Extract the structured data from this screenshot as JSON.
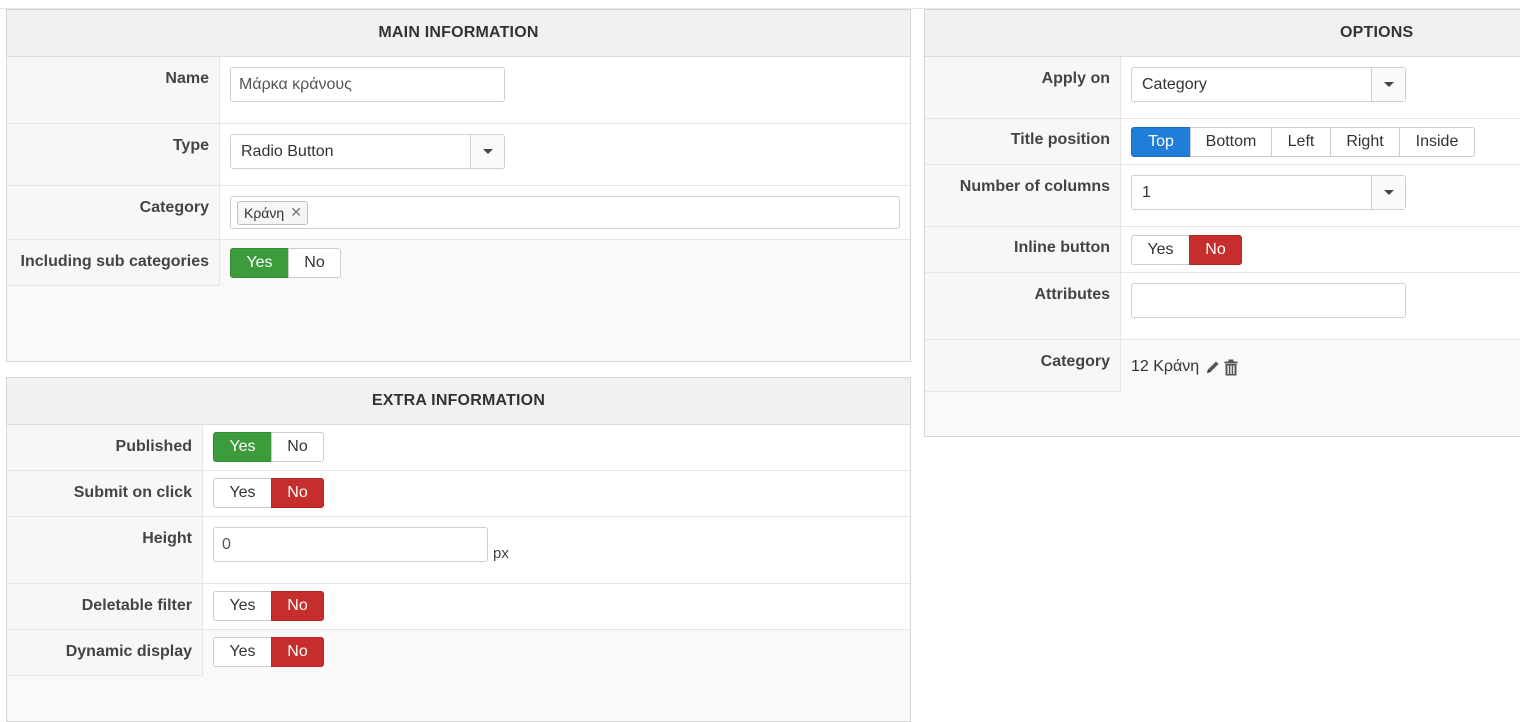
{
  "main_info": {
    "title": "MAIN INFORMATION",
    "name_label": "Name",
    "name_value": "Μάρκα κράνους",
    "type_label": "Type",
    "type_value": "Radio Button",
    "category_label": "Category",
    "category_tag": "Κράνη",
    "subcat_label": "Including sub categories",
    "subcat_yes": "Yes",
    "subcat_no": "No",
    "subcat_selected": "Yes"
  },
  "extra_info": {
    "title": "EXTRA INFORMATION",
    "published_label": "Published",
    "published_yes": "Yes",
    "published_no": "No",
    "published_selected": "Yes",
    "submit_label": "Submit on click",
    "submit_yes": "Yes",
    "submit_no": "No",
    "submit_selected": "No",
    "height_label": "Height",
    "height_value": "0",
    "height_unit": "px",
    "deletable_label": "Deletable filter",
    "deletable_yes": "Yes",
    "deletable_no": "No",
    "deletable_selected": "No",
    "dynamic_label": "Dynamic display",
    "dynamic_yes": "Yes",
    "dynamic_no": "No",
    "dynamic_selected": "No"
  },
  "options": {
    "title": "OPTIONS",
    "apply_label": "Apply on",
    "apply_value": "Category",
    "title_pos_label": "Title position",
    "title_pos_options": [
      "Top",
      "Bottom",
      "Left",
      "Right",
      "Inside"
    ],
    "title_pos_selected": "Top",
    "columns_label": "Number of columns",
    "columns_value": "1",
    "inline_label": "Inline button",
    "inline_yes": "Yes",
    "inline_no": "No",
    "inline_selected": "No",
    "attributes_label": "Attributes",
    "attributes_value": "",
    "category_label": "Category",
    "category_value": "12 Κράνη"
  },
  "colors": {
    "yes_active": "#3c9c3c",
    "no_active": "#c62d2d",
    "option_active": "#1f7fd8"
  }
}
